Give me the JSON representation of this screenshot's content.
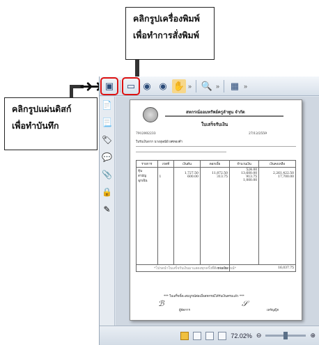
{
  "callouts": {
    "print": {
      "line1": "คลิกรูปเครื่องพิมพ์",
      "line2": "เพื่อทำการสั่งพิมพ์"
    },
    "save": {
      "line1": "คลิกรูปแผ่นดิสก์",
      "line2": "เพื่อทำบันทึก"
    }
  },
  "icons": {
    "arrow": "➜➜",
    "save": "▣",
    "print": "▭",
    "nav_up": "◉",
    "nav_down": "◉",
    "hand": "✋",
    "more": "»",
    "find": "🔍",
    "page_view": "▦",
    "sidebar": [
      "📄",
      "📃",
      "🏷",
      "💬",
      "📎",
      "🔒",
      "✎"
    ]
  },
  "document": {
    "title_line": "สหกรณ์ออมทรัพย์ครูลำพูน จำกัด",
    "receipt_label": "ใบเสร็จรับเงิน",
    "member_no": "7912002233",
    "date": "27/12/2559",
    "name_row": "ใบรับเงินจาก   นางอุษณีย์ ยศทองคำ",
    "table_headers": [
      "รายการ",
      "งวดที่",
      "เงินต้น",
      "ดอกเบี้ย",
      "จำนวนเงิน",
      "เงินคงเหลือ"
    ],
    "rows": [
      [
        "หุ้น",
        "",
        "",
        "",
        "524.00",
        ""
      ],
      [
        "สามัญ",
        "",
        "1,727.50",
        "11,872.50",
        "13,600.00",
        "2,261,422.50"
      ],
      [
        "ฉุกเฉิน",
        "1",
        "600.00",
        "313.75",
        "913.75",
        "17,700.00"
      ],
      [
        "",
        "",
        "",
        "",
        "1,000.00",
        ""
      ]
    ],
    "watermark": "*โปรดนำใบเสร็จรับเงินมาแสดงทุกครั้งที่ติดต่อสหกรณ์*",
    "total_label": "รวมเงิน",
    "total_value": "16,037.75",
    "note": "*** ใบเสร็จนี้จะสมบูรณ์ต่อเมื่อสหกรณ์ได้รับเงินครบแล้ว ***",
    "sign_left": "ผู้จัดการ",
    "sign_right": "เหรัญญิก"
  },
  "status": {
    "zoom": "72.02%"
  }
}
